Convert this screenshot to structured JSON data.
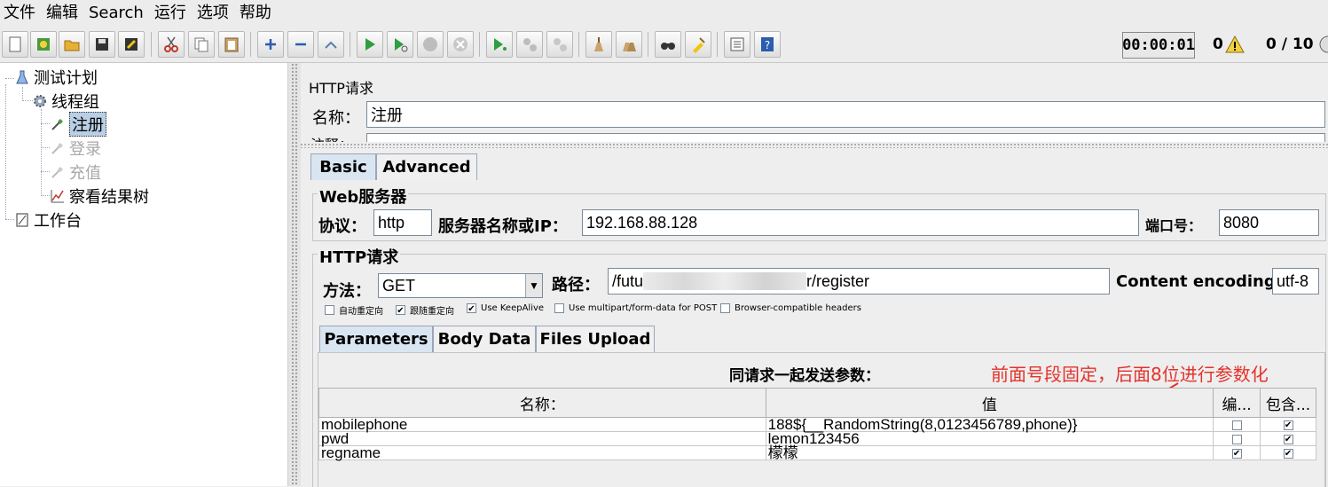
{
  "menu": [
    "文件",
    "编辑",
    "Search",
    "运行",
    "选项",
    "帮助"
  ],
  "status": {
    "timer": "00:00:01",
    "warnings": "0",
    "threads": "0 / 10"
  },
  "tree": {
    "root": "测试计划",
    "thread_group": "线程组",
    "items": [
      "注册",
      "登录",
      "充值",
      "察看结果树"
    ],
    "workbench": "工作台"
  },
  "panel": {
    "title": "HTTP请求",
    "name_label": "名称：",
    "name_value": "注册",
    "comment_label": "注释：",
    "tabs": [
      "Basic",
      "Advanced"
    ],
    "web_server": {
      "title": "Web服务器",
      "protocol_label": "协议：",
      "protocol": "http",
      "server_label": "服务器名称或IP：",
      "server": "192.168.88.128",
      "port_label": "端口号：",
      "port": "8080"
    },
    "http_request": {
      "title": "HTTP请求",
      "method_label": "方法：",
      "method": "GET",
      "path_label": "路径：",
      "path_start": "/futu",
      "path_end": "r/register",
      "encoding_label": "Content encoding:",
      "encoding": "utf-8"
    },
    "options": [
      {
        "label": "自动重定向",
        "checked": false
      },
      {
        "label": "跟随重定向",
        "checked": true
      },
      {
        "label": "Use KeepAlive",
        "checked": true
      },
      {
        "label": "Use multipart/form-data for POST",
        "checked": false
      },
      {
        "label": "Browser-compatible headers",
        "checked": false
      }
    ],
    "sub_tabs": [
      "Parameters",
      "Body Data",
      "Files Upload"
    ],
    "params_title": "同请求一起发送参数：",
    "columns": [
      "名称：",
      "值",
      "编...",
      "包含..."
    ],
    "rows": [
      {
        "name": "mobilephone",
        "value": "188${__RandomString(8,0123456789,phone)}",
        "encode": false,
        "include": true
      },
      {
        "name": "pwd",
        "value": "lemon123456",
        "encode": false,
        "include": true
      },
      {
        "name": "regname",
        "value": "檬檬",
        "encode": true,
        "include": true
      }
    ],
    "annotation": "前面号段固定，后面8位进行参数化"
  },
  "colors": {
    "annotation": "#e4322b",
    "selected": "#b8cfe5",
    "active_tab": "#d9e6f2"
  }
}
